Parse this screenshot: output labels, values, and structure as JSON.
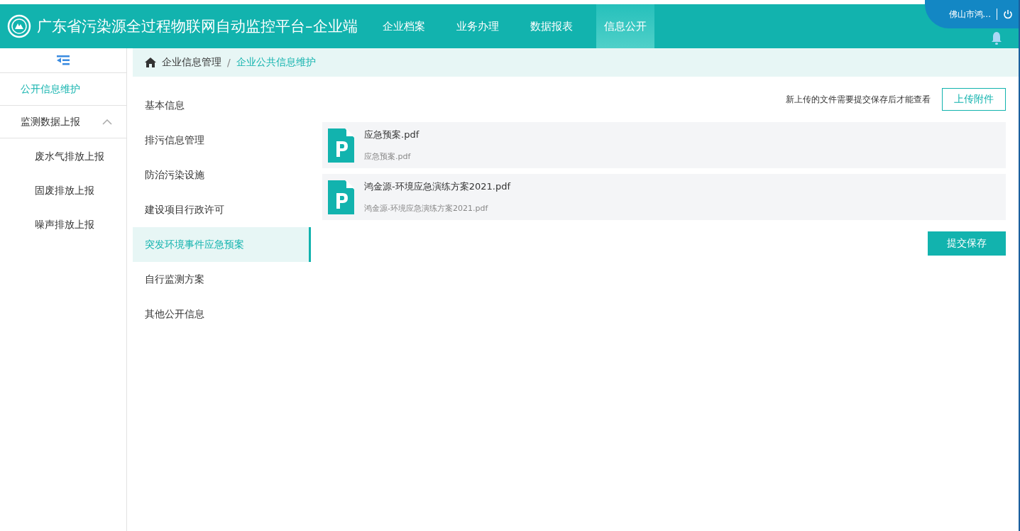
{
  "header": {
    "title": "广东省污染源全过程物联网自动监控平台–企业端",
    "nav": [
      {
        "label": "企业档案",
        "selected": false
      },
      {
        "label": "业务办理",
        "selected": false
      },
      {
        "label": "数据报表",
        "selected": false
      },
      {
        "label": "信息公开",
        "selected": true
      }
    ],
    "user": "佛山市鸿..."
  },
  "sidebar": {
    "items": [
      {
        "label": "公开信息维护",
        "selected": true
      },
      {
        "label": "监测数据上报",
        "selected": false,
        "expanded": true,
        "children": [
          {
            "label": "废水气排放上报",
            "selected": false
          },
          {
            "label": "固废排放上报",
            "selected": false
          },
          {
            "label": "噪声排放上报",
            "selected": false
          }
        ]
      }
    ]
  },
  "breadcrumb": [
    "企业信息管理",
    "企业公共信息维护"
  ],
  "breadcrumb_separator": "/",
  "tabs": [
    {
      "label": "基本信息",
      "selected": false
    },
    {
      "label": "排污信息管理",
      "selected": false
    },
    {
      "label": "防治污染设施",
      "selected": false
    },
    {
      "label": "建设项目行政许可",
      "selected": false
    },
    {
      "label": "突发环境事件应急预案",
      "selected": true
    },
    {
      "label": "自行监测方案",
      "selected": false
    },
    {
      "label": "其他公开信息",
      "selected": false
    }
  ],
  "upload_hint": "新上传的文件需要提交保存后才能查看",
  "upload_button": "上传附件",
  "files": [
    {
      "name": "应急预案.pdf",
      "subtitle": "应急预案.pdf"
    },
    {
      "name": "鸿金源-环境应急演练方案2021.pdf",
      "subtitle": "鸿金源-环境应急演练方案2021.pdf"
    }
  ],
  "submit_button": "提交保存"
}
